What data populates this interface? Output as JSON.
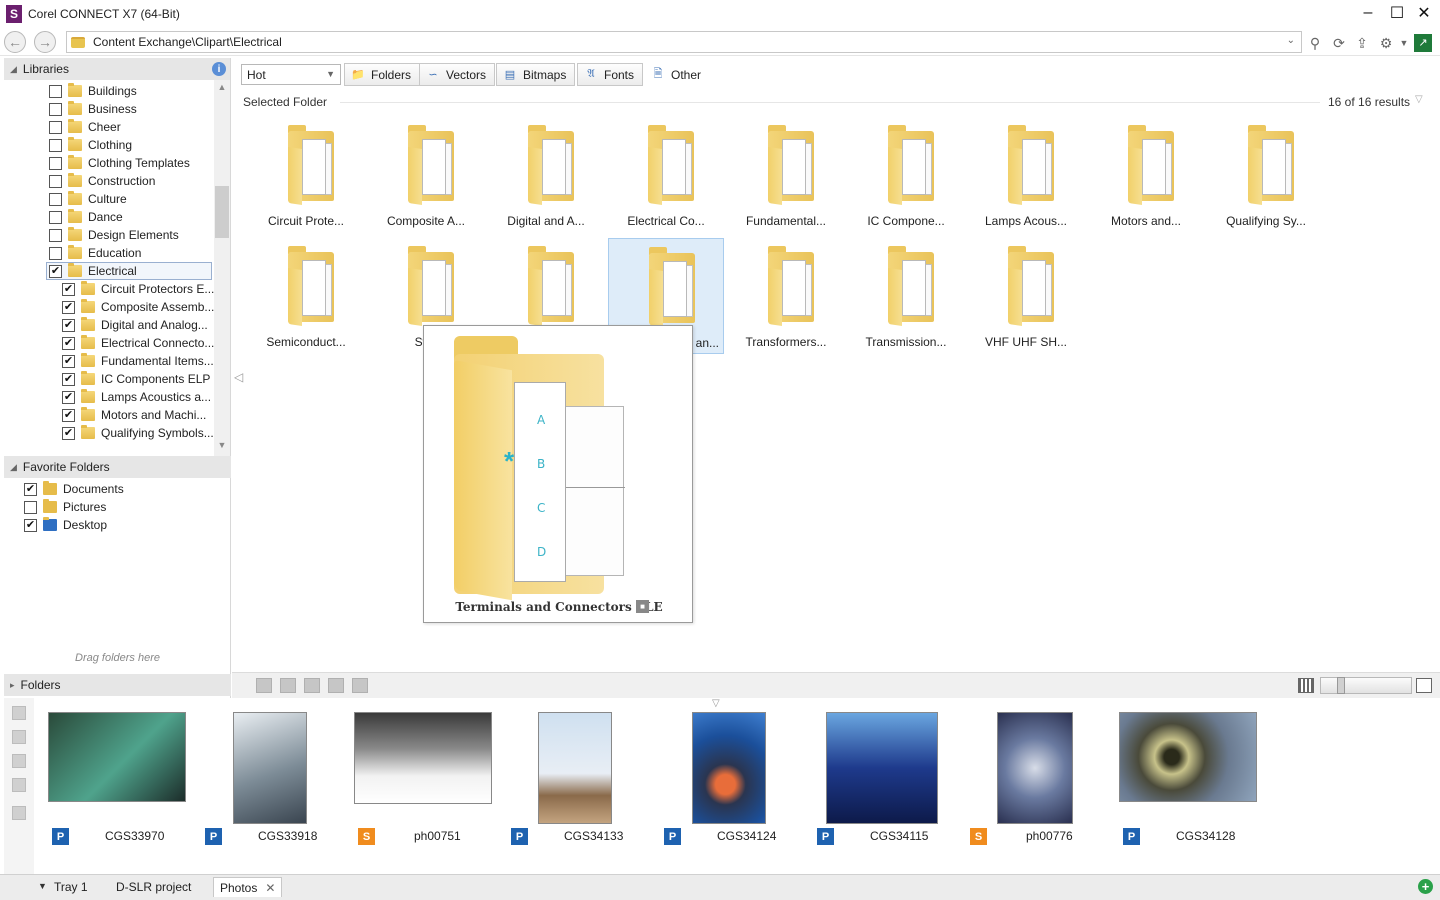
{
  "window": {
    "title": "Corel CONNECT X7 (64-Bit)",
    "logo": "S"
  },
  "address": {
    "path": "Content Exchange\\Clipart\\Electrical"
  },
  "libraries": {
    "title": "Libraries",
    "items": [
      {
        "label": "Buildings",
        "checked": false,
        "level": 0
      },
      {
        "label": "Business",
        "checked": false,
        "level": 0
      },
      {
        "label": "Cheer",
        "checked": false,
        "level": 0
      },
      {
        "label": "Clothing",
        "checked": false,
        "level": 0
      },
      {
        "label": "Clothing Templates",
        "checked": false,
        "level": 0
      },
      {
        "label": "Construction",
        "checked": false,
        "level": 0
      },
      {
        "label": "Culture",
        "checked": false,
        "level": 0
      },
      {
        "label": "Dance",
        "checked": false,
        "level": 0
      },
      {
        "label": "Design Elements",
        "checked": false,
        "level": 0
      },
      {
        "label": "Education",
        "checked": false,
        "level": 0
      },
      {
        "label": "Electrical",
        "checked": true,
        "level": 0,
        "selected": true
      },
      {
        "label": "Circuit Protectors E...",
        "checked": true,
        "level": 1
      },
      {
        "label": "Composite Assemb...",
        "checked": true,
        "level": 1
      },
      {
        "label": "Digital and Analog...",
        "checked": true,
        "level": 1
      },
      {
        "label": "Electrical Connecto...",
        "checked": true,
        "level": 1
      },
      {
        "label": "Fundamental Items...",
        "checked": true,
        "level": 1
      },
      {
        "label": "IC Components ELP",
        "checked": true,
        "level": 1
      },
      {
        "label": "Lamps Acoustics a...",
        "checked": true,
        "level": 1
      },
      {
        "label": "Motors and Machi...",
        "checked": true,
        "level": 1
      },
      {
        "label": "Qualifying Symbols...",
        "checked": true,
        "level": 1
      }
    ]
  },
  "favorites": {
    "title": "Favorite Folders",
    "items": [
      {
        "label": "Documents",
        "checked": true,
        "icon": "documents"
      },
      {
        "label": "Pictures",
        "checked": false,
        "icon": "pictures"
      },
      {
        "label": "Desktop",
        "checked": true,
        "icon": "desktop"
      }
    ],
    "drag_hint": "Drag folders here"
  },
  "folders_panel": {
    "title": "Folders"
  },
  "toolbar": {
    "sort": "Hot",
    "folders": "Folders",
    "vectors": "Vectors",
    "bitmaps": "Bitmaps",
    "fonts": "Fonts",
    "other": "Other"
  },
  "content": {
    "heading": "Selected Folder",
    "results": "16 of 16 results",
    "folders": [
      "Circuit Prote...",
      "Composite A...",
      "Digital and A...",
      "Electrical Co...",
      "Fundamental...",
      "IC Compone...",
      "Lamps Acous...",
      "Motors and...",
      "Qualifying Sy...",
      "Semiconduct...",
      "Swit",
      "",
      "an...",
      "Transformers...",
      "Transmission...",
      "VHF UHF SH..."
    ]
  },
  "preview": {
    "title": "Terminals and Connectors ELE",
    "letters": [
      "A",
      "B",
      "C",
      "D"
    ]
  },
  "tray": {
    "photos": [
      {
        "name": "CGS33970",
        "type": "P"
      },
      {
        "name": "CGS33918",
        "type": "P"
      },
      {
        "name": "ph00751",
        "type": "S"
      },
      {
        "name": "CGS34133",
        "type": "P"
      },
      {
        "name": "CGS34124",
        "type": "P"
      },
      {
        "name": "CGS34115",
        "type": "P"
      },
      {
        "name": "ph00776",
        "type": "S"
      },
      {
        "name": "CGS34128",
        "type": "P"
      }
    ],
    "tabs": [
      "Tray 1",
      "D-SLR project",
      "Photos"
    ]
  },
  "colors": {
    "badge_p": "#1e62b0",
    "badge_s": "#f08c1e",
    "folder": "#f3d579",
    "selection": "#deecf9"
  }
}
